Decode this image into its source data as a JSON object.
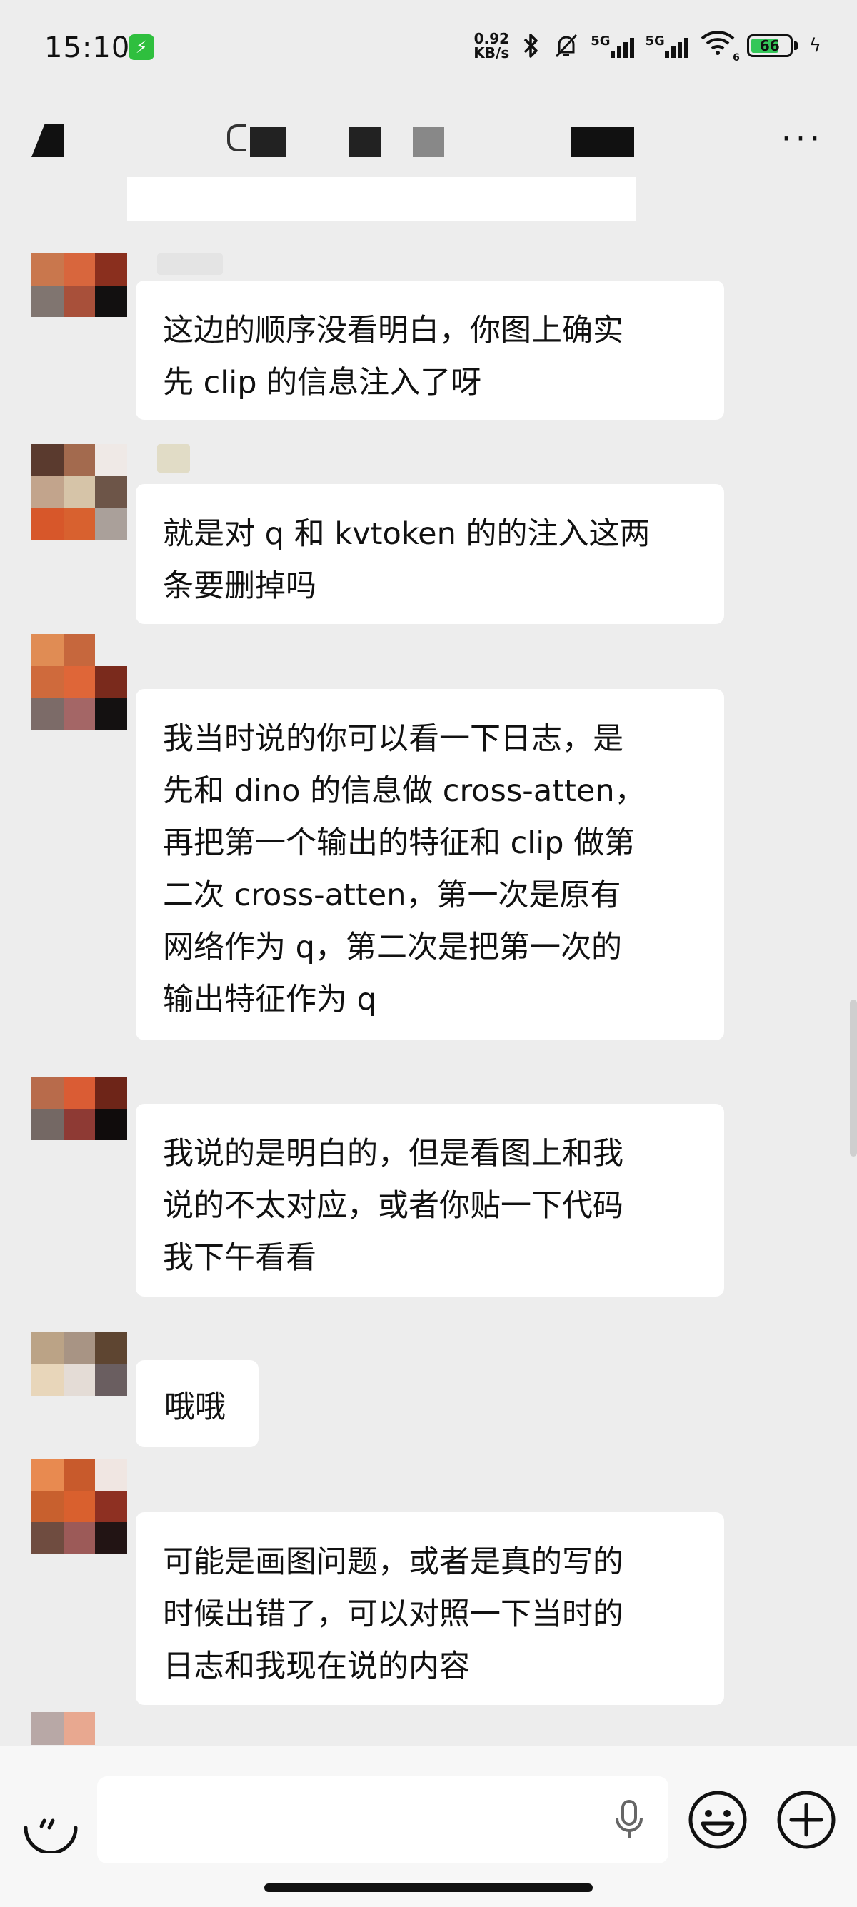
{
  "status_bar": {
    "time": "15:10",
    "net_speed_value": "0.92",
    "net_speed_unit": "KB/s",
    "signal_1_label": "5G",
    "signal_2_label": "5G",
    "wifi_label": "6",
    "battery_level": "66"
  },
  "chat": {
    "messages": [
      {
        "text": "这边的顺序没看明白，你图上确实\n先 clip 的信息注入了呀"
      },
      {
        "text": "就是对 q 和 kvtoken 的的注入这两\n条要删掉吗"
      },
      {
        "text": "我当时说的你可以看一下日志，是\n先和 dino 的信息做 cross-atten，\n再把第一个输出的特征和 clip 做第\n二次 cross-atten，第一次是原有\n网络作为 q，第二次是把第一次的\n输出特征作为 q"
      },
      {
        "text": "我说的是明白的，但是看图上和我\n说的不太对应，或者你贴一下代码\n我下午看看"
      },
      {
        "text": "哦哦"
      },
      {
        "text": "可能是画图问题，或者是真的写的\n时候出错了，可以对照一下当时的\n日志和我现在说的内容"
      }
    ]
  },
  "input_bar": {
    "text_value": "",
    "placeholder": ""
  },
  "colors": {
    "background": "#ededed",
    "bubble": "#ffffff",
    "battery_fill": "#34c759",
    "battery_saver": "#2fbf3e"
  }
}
